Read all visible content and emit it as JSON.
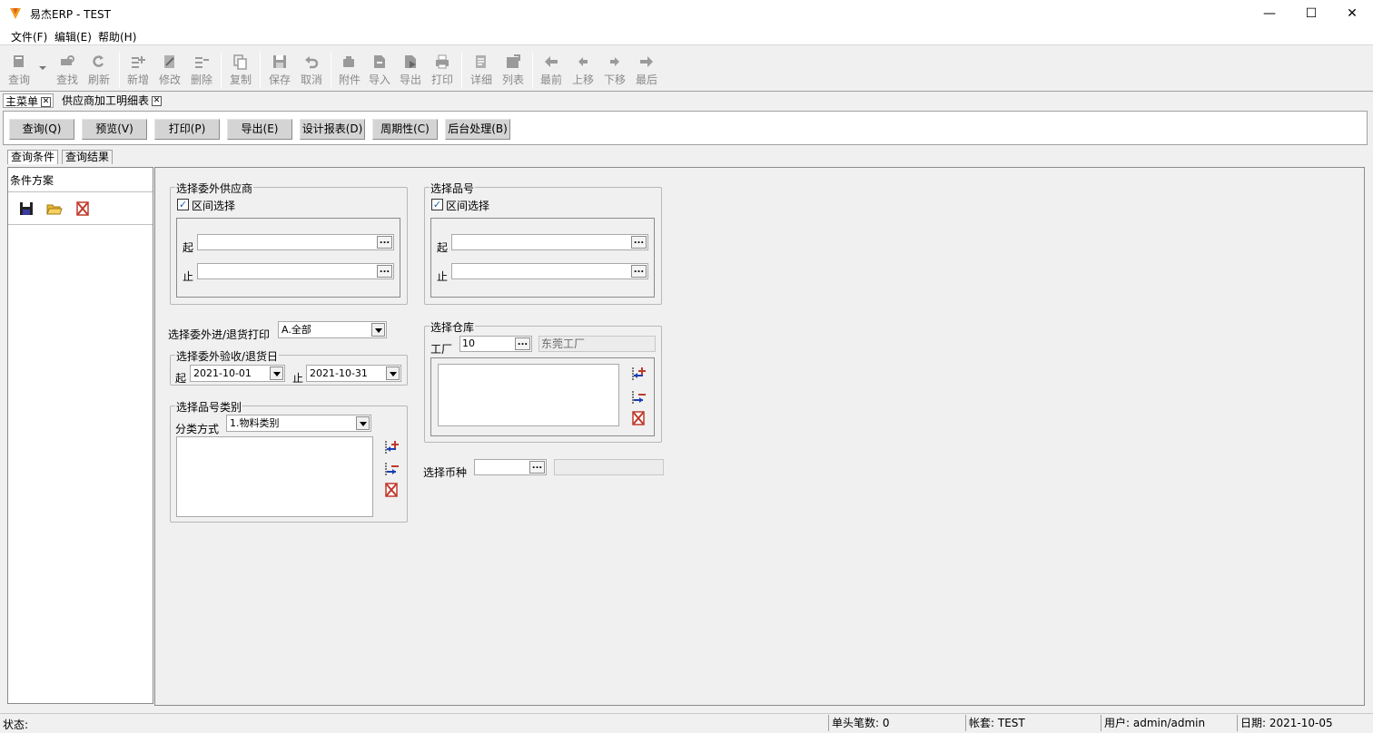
{
  "window": {
    "title": "易杰ERP - TEST",
    "min": "—",
    "max": "☐",
    "close": "✕"
  },
  "menu": [
    "文件(F)",
    "编辑(E)",
    "帮助(H)"
  ],
  "toolbar": {
    "query": "查询",
    "find": "查找",
    "refresh": "刷新",
    "add": "新增",
    "edit": "修改",
    "delete": "删除",
    "copy": "复制",
    "save": "保存",
    "cancel": "取消",
    "attach": "附件",
    "import": "导入",
    "export": "导出",
    "print": "打印",
    "detail": "详细",
    "list": "列表",
    "first": "最前",
    "up": "上移",
    "down": "下移",
    "last": "最后"
  },
  "doc_tabs": [
    "主菜单",
    "供应商加工明细表"
  ],
  "commands": [
    "查询(Q)",
    "预览(V)",
    "打印(P)",
    "导出(E)",
    "设计报表(D)",
    "周期性(C)",
    "后台处理(B)"
  ],
  "sub_tabs": [
    "查询条件",
    "查询结果"
  ],
  "left": {
    "title": "条件方案"
  },
  "supplier": {
    "title": "选择委外供应商",
    "range_label": "区间选择",
    "from": "起",
    "to": "止",
    "from_value": "",
    "to_value": ""
  },
  "item": {
    "title": "选择品号",
    "range_label": "区间选择",
    "from": "起",
    "to": "止",
    "from_value": "",
    "to_value": ""
  },
  "print_type": {
    "label": "选择委外进/退货打印",
    "value": "A.全部"
  },
  "date_range": {
    "title": "选择委外验收/退货日",
    "from": "起",
    "to": "止",
    "from_value": "2021-10-01",
    "to_value": "2021-10-31"
  },
  "category": {
    "title": "选择品号类别",
    "method_label": "分类方式",
    "method_value": "1.物料类别"
  },
  "warehouse": {
    "title": "选择仓库",
    "factory_label": "工厂",
    "factory_code": "10",
    "factory_name": "东莞工厂"
  },
  "currency": {
    "label": "选择币种",
    "code": "",
    "name": ""
  },
  "status": {
    "status_label": "状态:",
    "header_count": "单头笔数: 0",
    "account": "帐套: TEST",
    "user": "用户: admin/admin",
    "date": "日期: 2021-10-05"
  },
  "colors": {
    "accent": "#1a5fb4",
    "disabled": "#8a8a8a",
    "delete_red": "#c0392b"
  }
}
